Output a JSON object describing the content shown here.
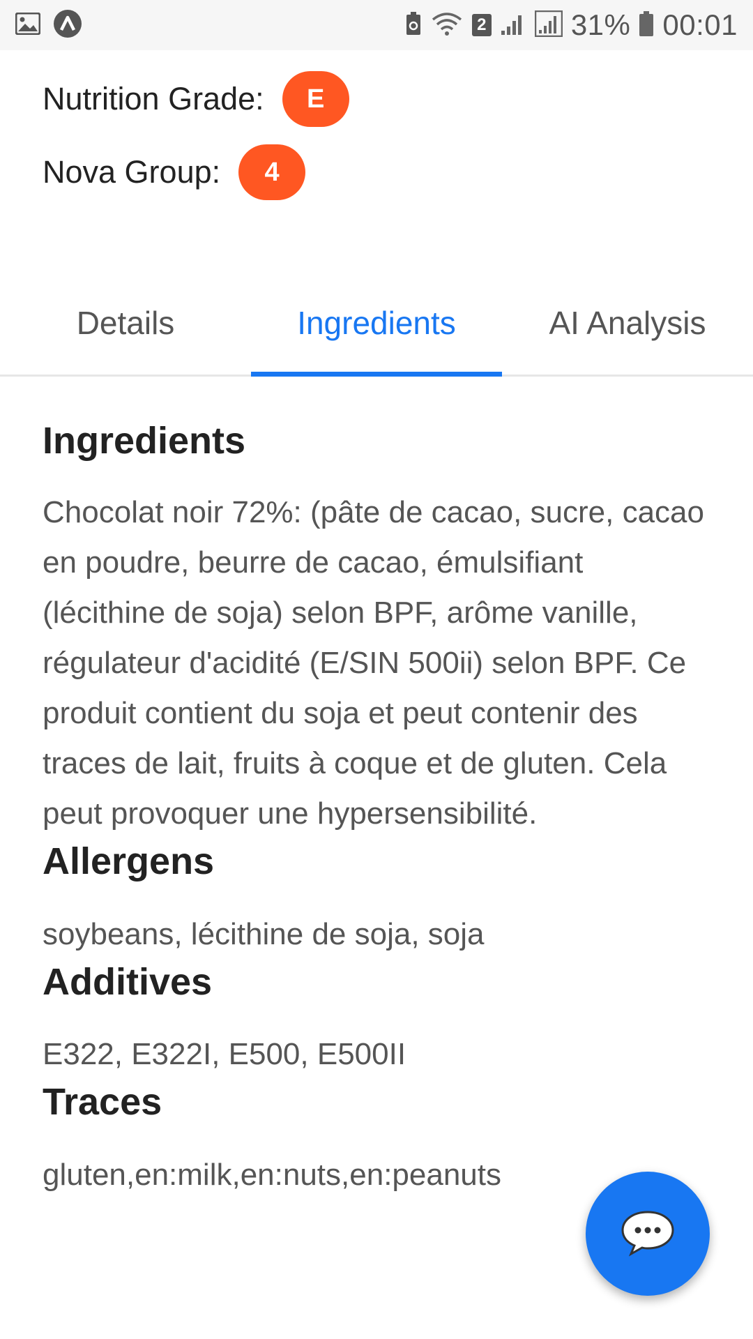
{
  "status_bar": {
    "left_icons": [
      "image-icon",
      "app-logo-icon"
    ],
    "right_icons": [
      "battery-saver-icon",
      "wifi-icon",
      "sim-icon",
      "signal-icon",
      "signal-icon",
      "battery-icon"
    ],
    "sim_number": "2",
    "battery_percent": "31%",
    "time": "00:01"
  },
  "product": {
    "nutrition_grade_label": "Nutrition Grade:",
    "nutrition_grade_value": "E",
    "nova_group_label": "Nova Group:",
    "nova_group_value": "4",
    "badge_color": "#ff5722"
  },
  "tabs": [
    {
      "label": "Details",
      "active": false
    },
    {
      "label": "Ingredients",
      "active": true
    },
    {
      "label": "AI Analysis",
      "active": false
    }
  ],
  "accent_color": "#1877f2",
  "sections": {
    "ingredients": {
      "title": "Ingredients",
      "text": "Chocolat noir 72%: (pâte de cacao, sucre, cacao en poudre, beurre de cacao, émulsifiant (lécithine de soja) selon BPF, arôme vanille, régulateur d'acidité (E/SIN 500ii) selon BPF. Ce produit contient du soja et peut contenir des traces de lait, fruits à coque et de gluten. Cela peut provoquer une hypersensibilité."
    },
    "allergens": {
      "title": "Allergens",
      "text": "soybeans, lécithine de soja, soja"
    },
    "additives": {
      "title": "Additives",
      "text": "E322, E322I, E500, E500II"
    },
    "traces": {
      "title": "Traces",
      "text": "gluten,en:milk,en:nuts,en:peanuts"
    }
  },
  "fab": {
    "icon": "chat-bubble-icon"
  }
}
